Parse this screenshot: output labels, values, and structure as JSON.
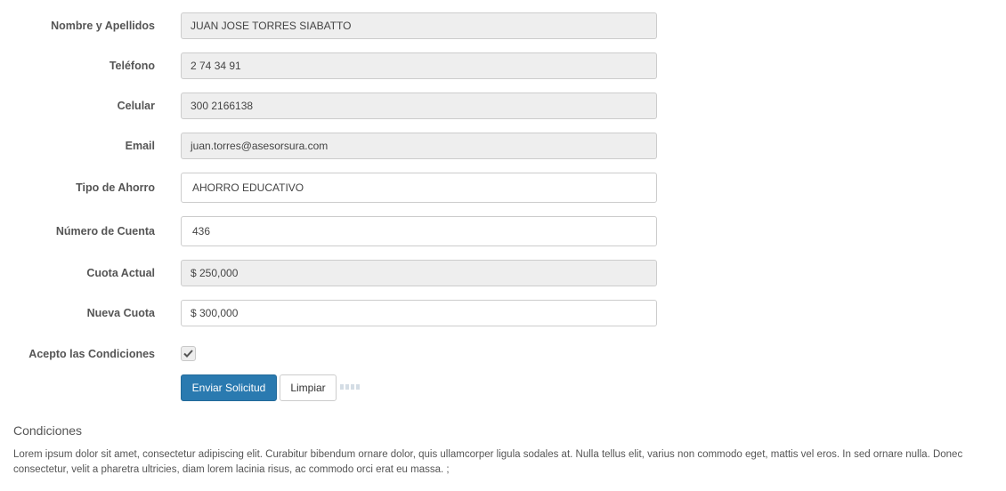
{
  "form": {
    "nombre": {
      "label": "Nombre y Apellidos",
      "value": "JUAN JOSE TORRES SIABATTO"
    },
    "telefono": {
      "label": "Teléfono",
      "value": "2 74 34 91"
    },
    "celular": {
      "label": "Celular",
      "value": "300 2166138"
    },
    "email": {
      "label": "Email",
      "value": "juan.torres@asesorsura.com"
    },
    "tipo_ahorro": {
      "label": "Tipo de Ahorro",
      "value": "AHORRO EDUCATIVO"
    },
    "numero_cuenta": {
      "label": "Número de Cuenta",
      "value": "436"
    },
    "cuota_actual": {
      "label": "Cuota Actual",
      "value": "$ 250,000"
    },
    "nueva_cuota": {
      "label": "Nueva Cuota",
      "value": "$ 300,000"
    },
    "acepto": {
      "label": "Acepto las Condiciones",
      "checked": true
    },
    "submit_label": "Enviar Solicitud",
    "reset_label": "Limpiar"
  },
  "conditions": {
    "title": "Condiciones",
    "text": "Lorem ipsum dolor sit amet, consectetur adipiscing elit. Curabitur bibendum ornare dolor, quis ullamcorper ligula sodales at. Nulla tellus elit, varius non commodo eget, mattis vel eros. In sed ornare nulla. Donec consectetur, velit a pharetra ultricies, diam lorem lacinia risus, ac commodo orci erat eu massa. ;"
  },
  "icons": {
    "checkbox": "check-icon",
    "loader": "loading-indicator-icon"
  },
  "colors": {
    "primary": "#2a7ab0",
    "readonly_bg": "#eeeeee",
    "label": "#555555"
  }
}
